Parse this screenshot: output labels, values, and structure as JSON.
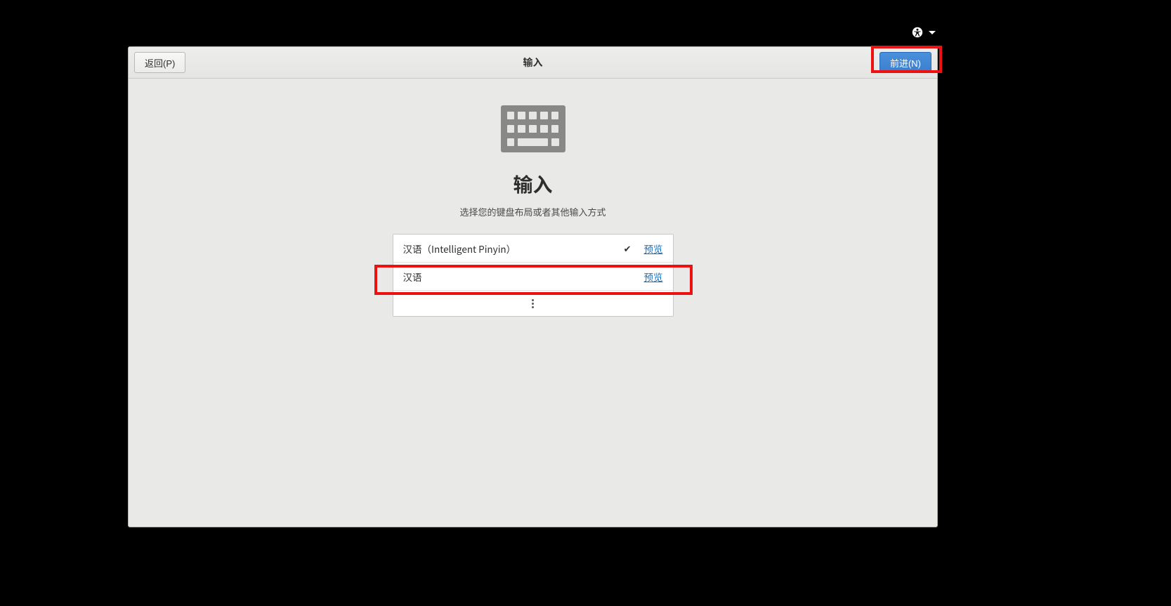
{
  "topbar": {
    "a11y_icon": "accessibility-icon"
  },
  "header": {
    "back_label": "返回(P)",
    "title": "输入",
    "next_label": "前进(N)"
  },
  "main": {
    "heading": "输入",
    "subheading": "选择您的键盘布局或者其他输入方式",
    "items": [
      {
        "label": "汉语（Intelligent Pinyin）",
        "selected": true,
        "preview_label": "预览"
      },
      {
        "label": "汉语",
        "selected": false,
        "preview_label": "预览"
      }
    ]
  }
}
